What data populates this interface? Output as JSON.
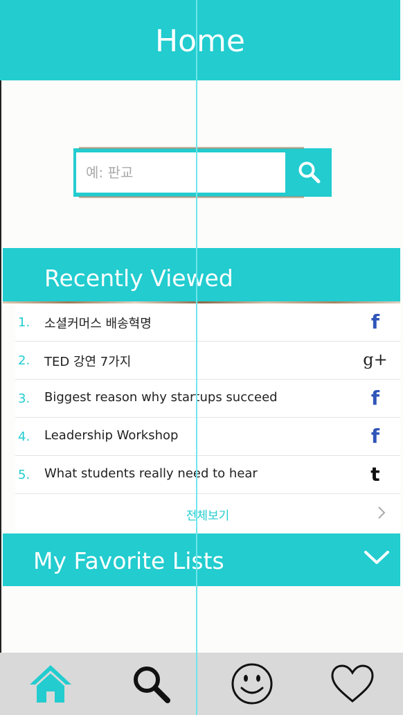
{
  "header": {
    "title": "Home"
  },
  "search": {
    "placeholder": "예: 판교"
  },
  "recent": {
    "title": "Recently Viewed",
    "items": [
      {
        "num": "1.",
        "title": "소셜커머스 배송혁명",
        "source": "f"
      },
      {
        "num": "2.",
        "title": "TED 강연 7가지",
        "source": "g+"
      },
      {
        "num": "3.",
        "title": "Biggest reason why startups succeed",
        "source": "f"
      },
      {
        "num": "4.",
        "title": "Leadership Workshop",
        "source": "f"
      },
      {
        "num": "5.",
        "title": "What students really need to hear",
        "source": "t"
      }
    ],
    "view_all": "전체보기"
  },
  "favorites": {
    "title": "My Favorite Lists"
  },
  "colors": {
    "accent": "#22cccf",
    "tabbar": "#d9d9d9",
    "facebook": "#2f55b8"
  },
  "tabs": [
    "home-icon",
    "search-icon",
    "smiley-icon",
    "heart-icon"
  ]
}
